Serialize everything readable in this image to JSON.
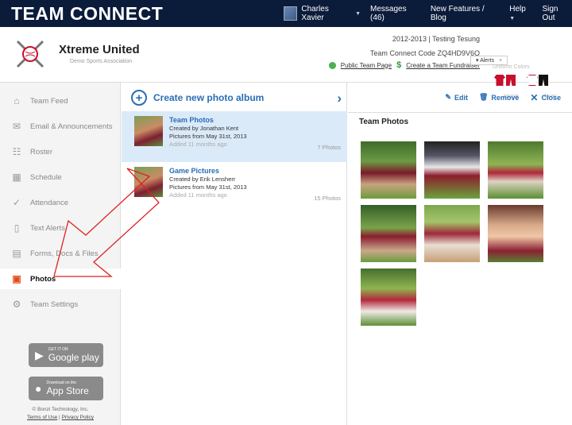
{
  "app": {
    "logo": "TEAM CONNECT"
  },
  "topnav": {
    "user": "Charles Xavier",
    "messages": "Messages (46)",
    "features": "New Features / Blog",
    "help": "Help",
    "signout": "Sign Out"
  },
  "header": {
    "team_name": "Xtreme United",
    "team_sub": "Demo Sports Association",
    "season": "2012-2013 | Testing Tesung",
    "code": "Team Connect Code ZQ4HD9V6Q",
    "public_page": "Public Team Page",
    "fundraiser": "Create a Team Fundraiser",
    "alerts": "Alerts",
    "alerts_close": "×",
    "uniform_label": "Uniform Colors",
    "home": "Home",
    "away": "Away"
  },
  "sidebar": {
    "items": [
      {
        "label": "Team Feed",
        "icon": "home-icon",
        "glyph": "⌂"
      },
      {
        "label": "Email & Announcements",
        "icon": "email-icon",
        "glyph": "✉"
      },
      {
        "label": "Roster",
        "icon": "roster-icon",
        "glyph": "☷"
      },
      {
        "label": "Schedule",
        "icon": "calendar-icon",
        "glyph": "▦"
      },
      {
        "label": "Attendance",
        "icon": "check-icon",
        "glyph": "✓"
      },
      {
        "label": "Text Alerts",
        "icon": "phone-icon",
        "glyph": "▯"
      },
      {
        "label": "Forms, Docs & Files",
        "icon": "document-icon",
        "glyph": "▤"
      },
      {
        "label": "Photos",
        "icon": "photos-icon",
        "glyph": "▣"
      },
      {
        "label": "Team Settings",
        "icon": "gear-icon",
        "glyph": "⚙"
      }
    ],
    "google_small": "GET IT ON",
    "google_large": "Google play",
    "apple_small": "Download on the",
    "apple_large": "App Store",
    "copyright": "© Bonzi Technology, Inc.",
    "terms": "Terms of Use",
    "privacy": "Privacy Policy"
  },
  "albums": {
    "create_label": "Create new photo album",
    "list": [
      {
        "title": "Team Photos",
        "created": "Created by Jonathan Kent",
        "pictures": "Pictures from May 31st, 2013",
        "added": "Added 11 months ago",
        "count": "7 Photos"
      },
      {
        "title": "Game Pictures",
        "created": "Created by Erik Lensherr",
        "pictures": "Pictures from May 31st, 2013",
        "added": "Added 11 months ago",
        "count": "15 Photos"
      }
    ]
  },
  "viewer": {
    "edit": "Edit",
    "remove": "Remove",
    "close": "Close",
    "title": "Team Photos"
  },
  "colors": {
    "brand_dark": "#0b1b3a",
    "accent_blue": "#2a6db5",
    "selected_bg": "#dbeaf8",
    "annotation_red": "#e02020"
  }
}
